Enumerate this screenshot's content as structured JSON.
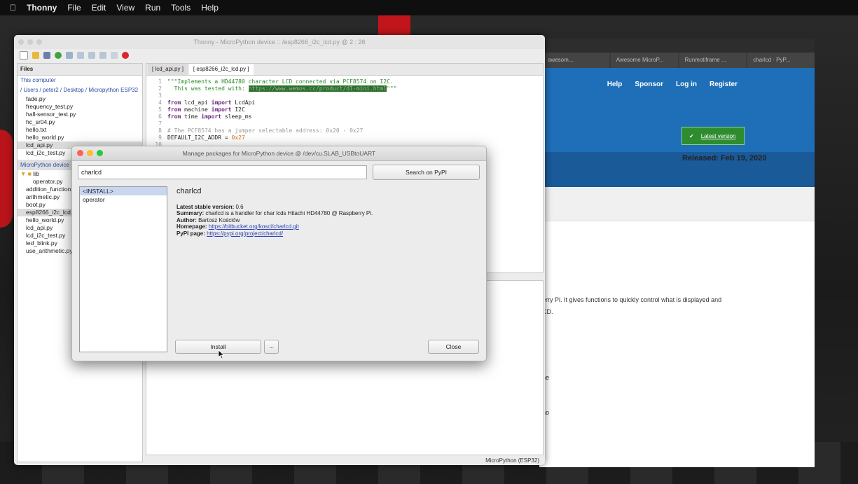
{
  "menubar": {
    "items": [
      "Thonny",
      "File",
      "Edit",
      "View",
      "Run",
      "Tools",
      "Help"
    ]
  },
  "browser": {
    "tabs": [
      "awesom...",
      "Awesome MicroP...",
      "Runmotiframe ...",
      "charlcd · PyP..."
    ],
    "nav_links": [
      "Help",
      "Sponsor",
      "Log in",
      "Register"
    ],
    "version_badge": "Latest version",
    "released": "Released: Feb 19, 2020",
    "desc_line1": "erry Pi. It gives functions to quickly control what is displayed and",
    "desc_line2": "CD.",
    "frag1": "ne",
    "frag2": "no"
  },
  "thonny": {
    "window_title": "Thonny - MicroPython device :: /esp8266_i2c_lcd.py @ 2 : 26",
    "files_tab": "Files",
    "computer_header": "This computer",
    "computer_path": "/ Users / peter2 / Desktop / Micropython ESP32",
    "computer_files": [
      "fade.py",
      "frequency_test.py",
      "hall-sensor_test.py",
      "hc_sr04.py",
      "hello.txt",
      "hello_world.py",
      "lcd_api.py",
      "lcd_i2c_test.py"
    ],
    "device_header": "MicroPython device",
    "device_files": [
      "lib",
      "operator.py",
      "addition_function.py",
      "arithmetic.py",
      "boot.py",
      "esp8266_i2c_lcd.py",
      "hello_world.py",
      "lcd_api.py",
      "lcd_i2c_test.py",
      "led_blink.py",
      "use_arithmetic.py"
    ],
    "editor_tabs": [
      "[ lcd_api.py ]",
      "[ esp8266_i2c_lcd.py ]"
    ],
    "status_bar": "MicroPython (ESP32)"
  },
  "dialog": {
    "title": "Manage packages for MicroPython device @ /dev/cu.SLAB_USBtoUART",
    "search_value": "charlcd",
    "search_button": "Search on PyPI",
    "list": [
      "<INSTALL>",
      "operator"
    ],
    "package_name": "charlcd",
    "latest_label": "Latest stable version:",
    "latest_value": "0.6",
    "summary_label": "Summary:",
    "summary_value": "charlcd is a handler for char lcds Hitachi HD44780 @ Raspberry Pi.",
    "author_label": "Author:",
    "author_value": "Bartosz Kościów",
    "homepage_label": "Homepage:",
    "homepage_value": "https://bitbucket.org/kosci/charlcd.git",
    "pypi_label": "PyPI page:",
    "pypi_value": "https://pypi.org/project/charlcd/",
    "install_button": "Install",
    "more_button": "...",
    "close_button": "Close"
  },
  "colors": {
    "accent_blue": "#1e6fb8",
    "badge_green": "#2e8b2e",
    "selection": "#c8d7ef"
  }
}
